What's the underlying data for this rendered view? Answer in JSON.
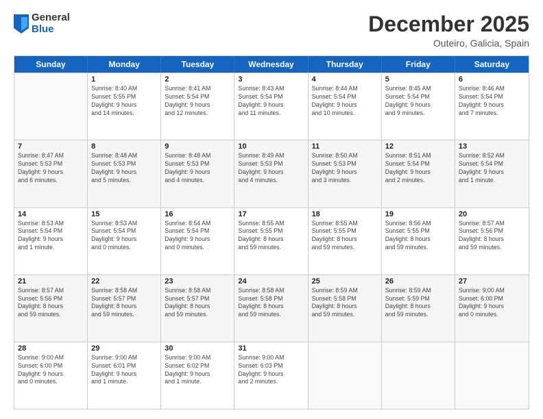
{
  "logo": {
    "general": "General",
    "blue": "Blue"
  },
  "title": "December 2025",
  "location": "Outeiro, Galicia, Spain",
  "days_of_week": [
    "Sunday",
    "Monday",
    "Tuesday",
    "Wednesday",
    "Thursday",
    "Friday",
    "Saturday"
  ],
  "weeks": [
    [
      {
        "day": "",
        "info": ""
      },
      {
        "day": "1",
        "info": "Sunrise: 8:40 AM\nSunset: 5:55 PM\nDaylight: 9 hours\nand 14 minutes."
      },
      {
        "day": "2",
        "info": "Sunrise: 8:41 AM\nSunset: 5:54 PM\nDaylight: 9 hours\nand 12 minutes."
      },
      {
        "day": "3",
        "info": "Sunrise: 8:43 AM\nSunset: 5:54 PM\nDaylight: 9 hours\nand 11 minutes."
      },
      {
        "day": "4",
        "info": "Sunrise: 8:44 AM\nSunset: 5:54 PM\nDaylight: 9 hours\nand 10 minutes."
      },
      {
        "day": "5",
        "info": "Sunrise: 8:45 AM\nSunset: 5:54 PM\nDaylight: 9 hours\nand 9 minutes."
      },
      {
        "day": "6",
        "info": "Sunrise: 8:46 AM\nSunset: 5:54 PM\nDaylight: 9 hours\nand 7 minutes."
      }
    ],
    [
      {
        "day": "7",
        "info": "Sunrise: 8:47 AM\nSunset: 5:53 PM\nDaylight: 9 hours\nand 6 minutes."
      },
      {
        "day": "8",
        "info": "Sunrise: 8:48 AM\nSunset: 5:53 PM\nDaylight: 9 hours\nand 5 minutes."
      },
      {
        "day": "9",
        "info": "Sunrise: 8:48 AM\nSunset: 5:53 PM\nDaylight: 9 hours\nand 4 minutes."
      },
      {
        "day": "10",
        "info": "Sunrise: 8:49 AM\nSunset: 5:53 PM\nDaylight: 9 hours\nand 4 minutes."
      },
      {
        "day": "11",
        "info": "Sunrise: 8:50 AM\nSunset: 5:53 PM\nDaylight: 9 hours\nand 3 minutes."
      },
      {
        "day": "12",
        "info": "Sunrise: 8:51 AM\nSunset: 5:54 PM\nDaylight: 9 hours\nand 2 minutes."
      },
      {
        "day": "13",
        "info": "Sunrise: 8:52 AM\nSunset: 5:54 PM\nDaylight: 9 hours\nand 1 minute."
      }
    ],
    [
      {
        "day": "14",
        "info": "Sunrise: 8:53 AM\nSunset: 5:54 PM\nDaylight: 9 hours\nand 1 minute."
      },
      {
        "day": "15",
        "info": "Sunrise: 8:53 AM\nSunset: 5:54 PM\nDaylight: 9 hours\nand 0 minutes."
      },
      {
        "day": "16",
        "info": "Sunrise: 8:54 AM\nSunset: 5:54 PM\nDaylight: 9 hours\nand 0 minutes."
      },
      {
        "day": "17",
        "info": "Sunrise: 8:55 AM\nSunset: 5:55 PM\nDaylight: 8 hours\nand 59 minutes."
      },
      {
        "day": "18",
        "info": "Sunrise: 8:55 AM\nSunset: 5:55 PM\nDaylight: 8 hours\nand 59 minutes."
      },
      {
        "day": "19",
        "info": "Sunrise: 8:56 AM\nSunset: 5:55 PM\nDaylight: 8 hours\nand 59 minutes."
      },
      {
        "day": "20",
        "info": "Sunrise: 8:57 AM\nSunset: 5:56 PM\nDaylight: 8 hours\nand 59 minutes."
      }
    ],
    [
      {
        "day": "21",
        "info": "Sunrise: 8:57 AM\nSunset: 5:56 PM\nDaylight: 8 hours\nand 59 minutes."
      },
      {
        "day": "22",
        "info": "Sunrise: 8:58 AM\nSunset: 5:57 PM\nDaylight: 8 hours\nand 59 minutes."
      },
      {
        "day": "23",
        "info": "Sunrise: 8:58 AM\nSunset: 5:57 PM\nDaylight: 8 hours\nand 59 minutes."
      },
      {
        "day": "24",
        "info": "Sunrise: 8:58 AM\nSunset: 5:58 PM\nDaylight: 8 hours\nand 59 minutes."
      },
      {
        "day": "25",
        "info": "Sunrise: 8:59 AM\nSunset: 5:58 PM\nDaylight: 8 hours\nand 59 minutes."
      },
      {
        "day": "26",
        "info": "Sunrise: 8:59 AM\nSunset: 5:59 PM\nDaylight: 8 hours\nand 59 minutes."
      },
      {
        "day": "27",
        "info": "Sunrise: 9:00 AM\nSunset: 6:00 PM\nDaylight: 9 hours\nand 0 minutes."
      }
    ],
    [
      {
        "day": "28",
        "info": "Sunrise: 9:00 AM\nSunset: 6:00 PM\nDaylight: 9 hours\nand 0 minutes."
      },
      {
        "day": "29",
        "info": "Sunrise: 9:00 AM\nSunset: 6:01 PM\nDaylight: 9 hours\nand 1 minute."
      },
      {
        "day": "30",
        "info": "Sunrise: 9:00 AM\nSunset: 6:02 PM\nDaylight: 9 hours\nand 1 minute."
      },
      {
        "day": "31",
        "info": "Sunrise: 9:00 AM\nSunset: 6:03 PM\nDaylight: 9 hours\nand 2 minutes."
      },
      {
        "day": "",
        "info": ""
      },
      {
        "day": "",
        "info": ""
      },
      {
        "day": "",
        "info": ""
      }
    ]
  ]
}
